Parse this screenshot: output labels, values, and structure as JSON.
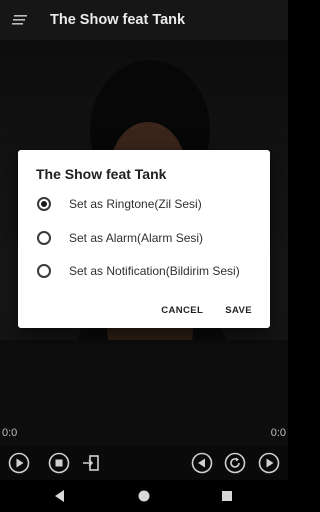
{
  "app_bar": {
    "title": "The Show feat Tank",
    "icon": "menu-icon"
  },
  "player": {
    "time_elapsed": "0:0",
    "time_total": "0:0",
    "controls": [
      "play-icon",
      "stop-icon",
      "exit-icon",
      "previous-icon",
      "repeat-icon",
      "next-icon"
    ]
  },
  "dialog": {
    "title": "The Show feat Tank",
    "options": [
      {
        "label": "Set as Ringtone(Zil Sesi)",
        "selected": true
      },
      {
        "label": "Set as Alarm(Alarm Sesi)",
        "selected": false
      },
      {
        "label": "Set as Notification(Bildirim Sesi)",
        "selected": false
      }
    ],
    "cancel_label": "CANCEL",
    "save_label": "SAVE"
  },
  "navbar": {
    "icons": [
      "back-icon",
      "home-icon",
      "recents-icon"
    ]
  },
  "colors": {
    "dialog_bg": "#ffffff",
    "app_bar_bg": "#161616",
    "icon": "#d0d0d0"
  }
}
